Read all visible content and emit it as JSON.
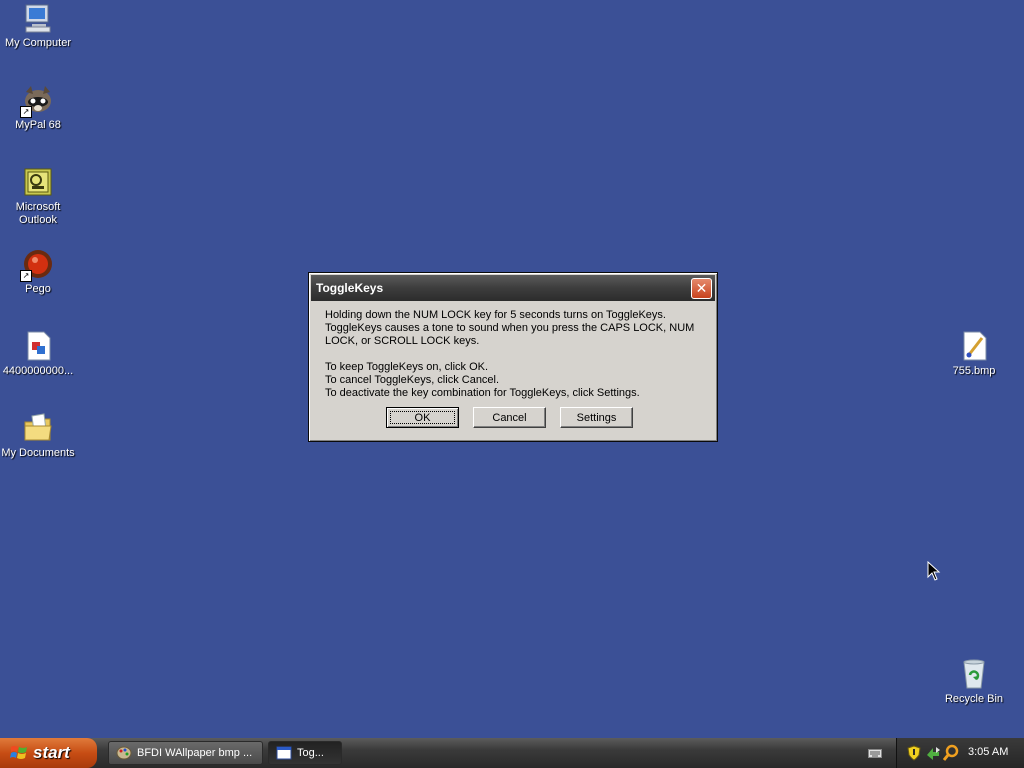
{
  "desktop": {
    "icons_left": [
      {
        "label": "My Computer"
      },
      {
        "label": "MyPal 68"
      },
      {
        "label": "Microsoft\nOutlook"
      },
      {
        "label": "Pego"
      },
      {
        "label": "4400000000..."
      },
      {
        "label": "My Documents"
      }
    ],
    "icons_right": [
      {
        "label": "755.bmp"
      },
      {
        "label": "Recycle Bin"
      }
    ]
  },
  "dialog": {
    "title": "ToggleKeys",
    "paragraph1": "Holding down the NUM LOCK key for 5 seconds turns on ToggleKeys.\nToggleKeys causes a tone to sound when you press the CAPS LOCK, NUM\nLOCK, or SCROLL LOCK keys.",
    "paragraph2": "To keep ToggleKeys on, click OK.\nTo cancel ToggleKeys, click Cancel.\nTo deactivate the key combination for ToggleKeys, click Settings.",
    "buttons": {
      "ok": "OK",
      "cancel": "Cancel",
      "settings": "Settings"
    },
    "close_glyph": "✕"
  },
  "taskbar": {
    "start_label": "start",
    "tasks": [
      {
        "label": "BFDI WAllpaper bmp ...",
        "icon": "paint-icon"
      },
      {
        "label": "Tog...",
        "icon": "window-icon"
      }
    ],
    "clock": "3:05 AM"
  }
}
